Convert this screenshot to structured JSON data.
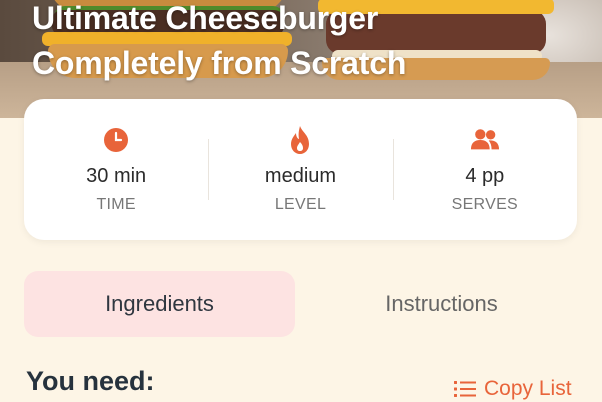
{
  "hero": {
    "title_line1": "Ultimate Cheeseburger",
    "title_line2": "Completely from Scratch"
  },
  "stats": [
    {
      "icon": "clock-icon",
      "value": "30 min",
      "label": "TIME"
    },
    {
      "icon": "flame-icon",
      "value": "medium",
      "label": "LEVEL"
    },
    {
      "icon": "people-icon",
      "value": "4 pp",
      "label": "SERVES"
    }
  ],
  "tabs": {
    "ingredients": "Ingredients",
    "instructions": "Instructions",
    "active": "ingredients"
  },
  "section": {
    "title": "You need:",
    "copy_list_label": "Copy List"
  },
  "colors": {
    "accent": "#e8643a",
    "active_tab_bg": "#fde3e2",
    "page_bg": "#fdf5e6",
    "card_bg": "#ffffff"
  }
}
